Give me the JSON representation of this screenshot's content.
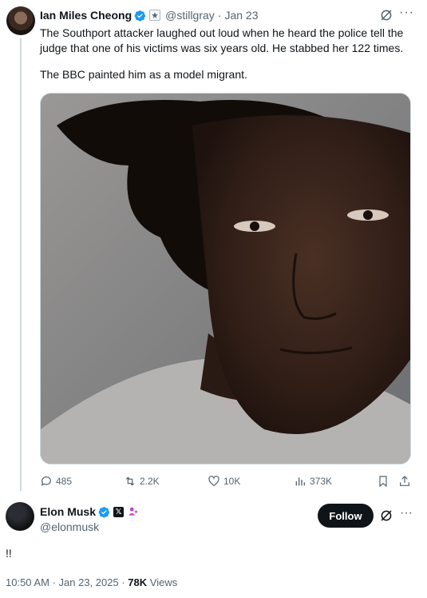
{
  "quoted_tweet": {
    "author_name": "Ian Miles Cheong",
    "author_handle": "@stillgray",
    "separator": "·",
    "date": "Jan 23",
    "paragraphs": [
      "The Southport attacker laughed out loud when he heard the police tell the judge that one of his victims was six years old. He stabbed her 122 times.",
      "The BBC painted him as a model migrant."
    ],
    "actions": {
      "replies": "485",
      "reposts": "2.2K",
      "likes": "10K",
      "views": "373K"
    }
  },
  "reply": {
    "author_name": "Elon Musk",
    "author_handle": "@elonmusk",
    "follow_label": "Follow",
    "text": "!!",
    "time": "10:50 AM",
    "date": "Jan 23, 2025",
    "views_count": "78K",
    "views_label": "Views"
  },
  "colors": {
    "verified": "#1d9bf0",
    "secondary_text": "#536471",
    "primary_text": "#0f1419",
    "follow_bg": "#0f1419",
    "thread_line": "#cfd9de",
    "affiliate_badge": "#c33ccc"
  },
  "icons": [
    "verified-icon",
    "affiliate-icon",
    "grok-icon",
    "more-icon",
    "reply-icon",
    "repost-icon",
    "like-icon",
    "views-icon",
    "bookmark-icon",
    "share-icon",
    "x-badge-icon"
  ]
}
